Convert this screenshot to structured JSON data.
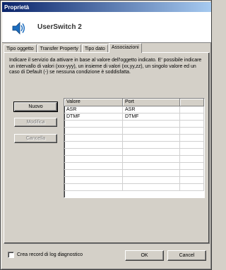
{
  "window": {
    "title": "Proprietà"
  },
  "header": {
    "name": "UserSwitch 2",
    "icon": "speaker-icon"
  },
  "tabs": [
    {
      "label": "Tipo oggetto"
    },
    {
      "label": "Transfer Property"
    },
    {
      "label": "Tipo dato"
    },
    {
      "label": "Associazioni"
    }
  ],
  "panel": {
    "description": "Indicare il servizio da attivare in base al valore dell'oggetto indicato. E' possibile indicare un intervallo di valori (xxx-yyy), un insieme di valori (xx,yy,zz), un singolo valore ed un caso di Default (-) se nessuna condizione è soddisfatta.",
    "buttons": {
      "new": "Nuovo",
      "edit": "Modifica",
      "delete": "Cancella"
    },
    "table": {
      "columns": [
        "Valore",
        "Port",
        ""
      ],
      "rows": [
        {
          "valore": "ASR",
          "port": "ASR"
        },
        {
          "valore": "DTMF",
          "port": "DTMF"
        }
      ]
    }
  },
  "footer": {
    "log_label": "Crea record di log diagnostico",
    "log_checked": false,
    "ok": "OK",
    "cancel": "Cancel"
  }
}
